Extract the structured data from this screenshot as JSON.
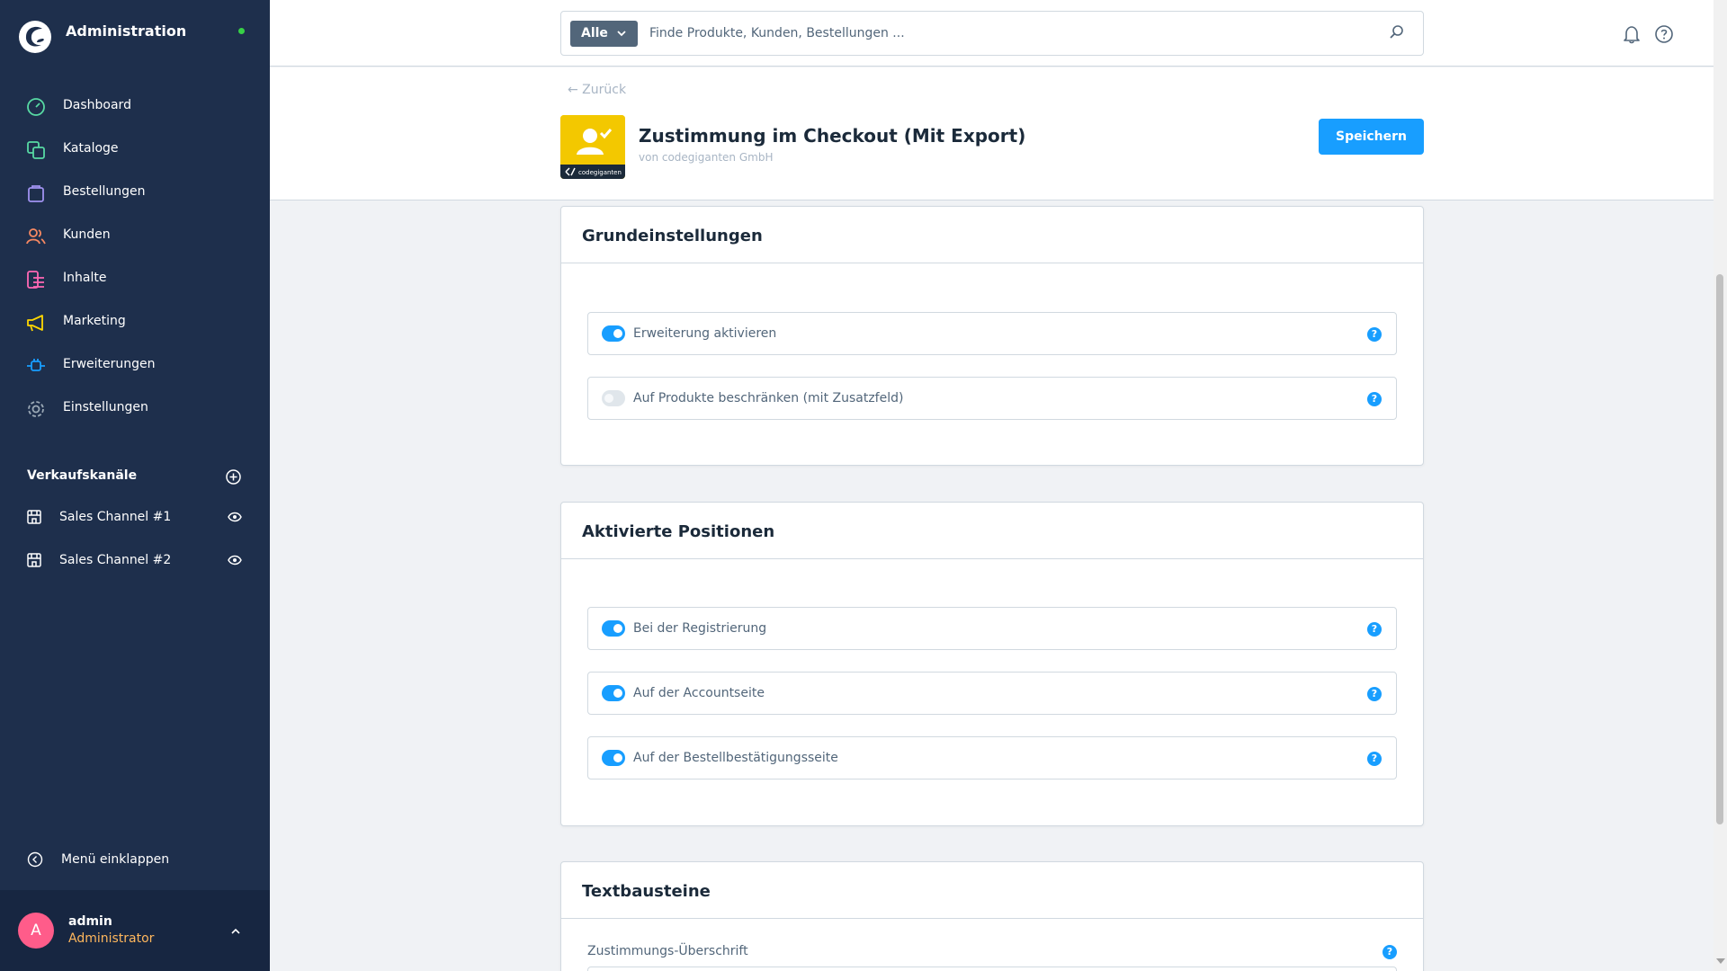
{
  "sidebar": {
    "title": "Administration",
    "nav": [
      {
        "label": "Dashboard",
        "icon": "dashboard-icon",
        "color": "#57d9a3"
      },
      {
        "label": "Kataloge",
        "icon": "catalog-icon",
        "color": "#57d9a3"
      },
      {
        "label": "Bestellungen",
        "icon": "shopping-bag-icon",
        "color": "#a092f0"
      },
      {
        "label": "Kunden",
        "icon": "customers-icon",
        "color": "#f88962"
      },
      {
        "label": "Inhalte",
        "icon": "content-icon",
        "color": "#ff68b4"
      },
      {
        "label": "Marketing",
        "icon": "megaphone-icon",
        "color": "#ffd700"
      },
      {
        "label": "Erweiterungen",
        "icon": "plug-icon",
        "color": "#189eff"
      },
      {
        "label": "Einstellungen",
        "icon": "gear-icon",
        "color": "#9aa8b5"
      }
    ],
    "sales_channels_title": "Verkaufskanäle",
    "sales_channels": [
      {
        "label": "Sales Channel #1"
      },
      {
        "label": "Sales Channel #2"
      }
    ],
    "collapse_label": "Menü einklappen",
    "user": {
      "initial": "A",
      "name": "admin",
      "role": "Administrator"
    }
  },
  "search": {
    "type_label": "Alle",
    "placeholder": "Finde Produkte, Kunden, Bestellungen ..."
  },
  "header": {
    "back_label": "← Zurück",
    "title": "Zustimmung im Checkout (Mit Export)",
    "vendor": "von codegiganten GmbH",
    "logo_text": "codegiganten",
    "save_label": "Speichern"
  },
  "cards": {
    "basic": {
      "title": "Grundeinstellungen",
      "fields": [
        {
          "label": "Erweiterung aktivieren",
          "on": true
        },
        {
          "label": "Auf Produkte beschränken (mit Zusatzfeld)",
          "on": false
        }
      ]
    },
    "positions": {
      "title": "Aktivierte Positionen",
      "fields": [
        {
          "label": "Bei der Registrierung",
          "on": true
        },
        {
          "label": "Auf der Accountseite",
          "on": true
        },
        {
          "label": "Auf der Bestellbestätigungsseite",
          "on": true
        }
      ]
    },
    "texts": {
      "title": "Textbausteine",
      "field_label": "Zustimmungs-Überschrift"
    }
  },
  "help_symbol": "?"
}
